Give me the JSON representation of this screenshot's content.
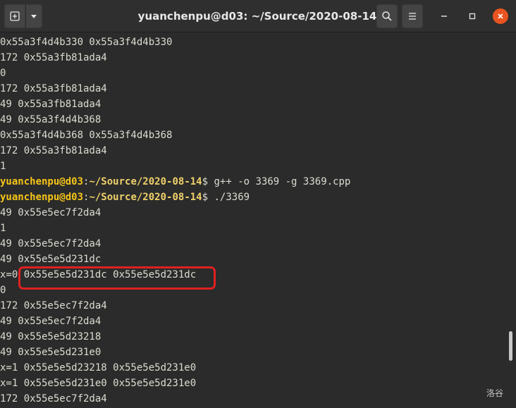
{
  "window": {
    "title": "yuanchenpu@d03: ~/Source/2020-08-14",
    "accent_close": "#e95420"
  },
  "titlebar": {
    "new_tab_icon": "new-tab-icon",
    "menu_icon": "chevron-down-icon",
    "search_icon": "search-icon",
    "hamburger_icon": "hamburger-menu-icon",
    "minimize_glyph": "–",
    "maximize_glyph": "□",
    "close_glyph": "✕"
  },
  "prompt": {
    "user_host": "yuanchenpu@d03",
    "path": "~/Source/2020-08-14",
    "symbol": "$",
    "user_color": "#f5c518"
  },
  "terminal_lines": [
    {
      "type": "out",
      "text": "0x55a3f4d4b330 0x55a3f4d4b330"
    },
    {
      "type": "out",
      "text": "172 0x55a3fb81ada4"
    },
    {
      "type": "out",
      "text": "0"
    },
    {
      "type": "out",
      "text": "172 0x55a3fb81ada4"
    },
    {
      "type": "out",
      "text": "49 0x55a3fb81ada4"
    },
    {
      "type": "out",
      "text": "49 0x55a3f4d4b368"
    },
    {
      "type": "out",
      "text": "0x55a3f4d4b368 0x55a3f4d4b368"
    },
    {
      "type": "out",
      "text": "172 0x55a3fb81ada4"
    },
    {
      "type": "out",
      "text": "1"
    },
    {
      "type": "prompt",
      "text": " g++ -o 3369 -g 3369.cpp"
    },
    {
      "type": "prompt",
      "text": " ./3369"
    },
    {
      "type": "out",
      "text": "49 0x55e5ec7f2da4"
    },
    {
      "type": "out",
      "text": "1"
    },
    {
      "type": "out",
      "text": "49 0x55e5ec7f2da4"
    },
    {
      "type": "out",
      "text": "49 0x55e5e5d231dc"
    },
    {
      "type": "out",
      "text": "x=0 0x55e5e5d231dc 0x55e5e5d231dc"
    },
    {
      "type": "out",
      "text": "0"
    },
    {
      "type": "out",
      "text": "172 0x55e5ec7f2da4"
    },
    {
      "type": "out",
      "text": "49 0x55e5ec7f2da4"
    },
    {
      "type": "out",
      "text": "49 0x55e5e5d23218"
    },
    {
      "type": "out",
      "text": "49 0x55e5e5d231e0"
    },
    {
      "type": "out",
      "text": "x=1 0x55e5e5d23218 0x55e5e5d231e0"
    },
    {
      "type": "out",
      "text": "x=1 0x55e5e5d231e0 0x55e5e5d231e0"
    },
    {
      "type": "out",
      "text": "172 0x55e5ec7f2da4"
    }
  ],
  "watermark": "洛谷"
}
